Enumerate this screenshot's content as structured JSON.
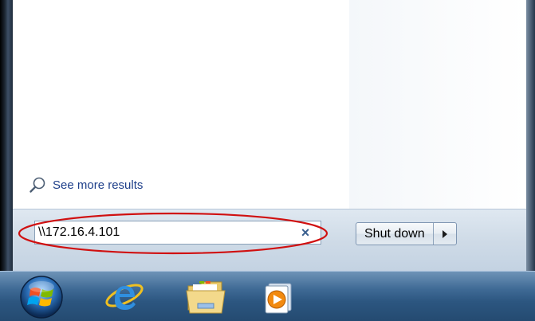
{
  "results": {
    "see_more_label": "See more results"
  },
  "search": {
    "value": "\\\\172.16.4.101",
    "clear_glyph": "×"
  },
  "shutdown": {
    "label": "Shut down"
  },
  "taskbar": {
    "items": [
      {
        "name": "start-orb",
        "icon": "windows-logo-icon"
      },
      {
        "name": "internet-explorer",
        "icon": "internet-explorer-icon"
      },
      {
        "name": "windows-explorer",
        "icon": "folder-icon"
      },
      {
        "name": "media-player",
        "icon": "media-player-icon"
      }
    ]
  },
  "colors": {
    "highlight": "#d01010",
    "link": "#1e3f8a",
    "taskbar": "#2c5680"
  }
}
